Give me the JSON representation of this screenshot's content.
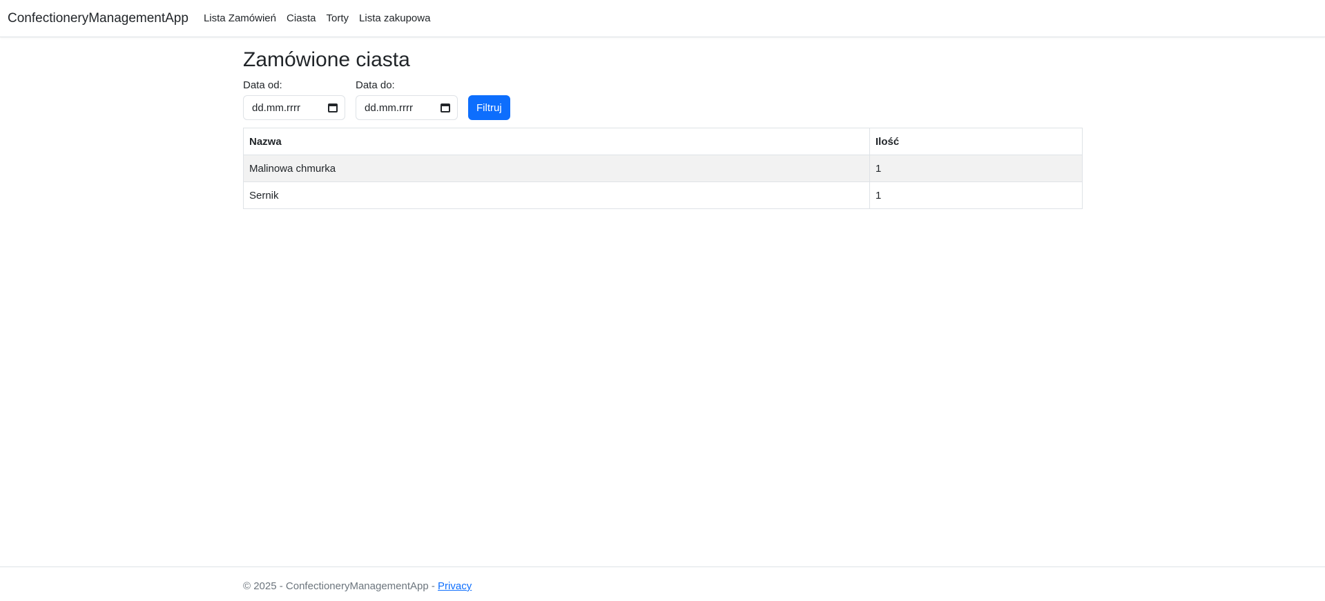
{
  "navbar": {
    "brand": "ConfectioneryManagementApp",
    "links": [
      {
        "label": "Lista Zamówień"
      },
      {
        "label": "Ciasta"
      },
      {
        "label": "Torty"
      },
      {
        "label": "Lista zakupowa"
      }
    ]
  },
  "main": {
    "title": "Zamówione ciasta",
    "filter": {
      "date_from_label": "Data od:",
      "date_from_placeholder": "dd.mm.rrrr",
      "date_to_label": "Data do:",
      "date_to_placeholder": "dd.mm.rrrr",
      "submit_label": "Filtruj"
    },
    "table": {
      "columns": [
        "Nazwa",
        "Ilość"
      ],
      "rows": [
        [
          "Malinowa chmurka",
          "1"
        ],
        [
          "Sernik",
          "1"
        ]
      ]
    }
  },
  "footer": {
    "copyright": "© 2025 - ConfectioneryManagementApp - ",
    "privacy_label": "Privacy"
  },
  "colors": {
    "accent": "#0d6efd",
    "striped_row": "#f2f2f2",
    "border": "#dee2e6",
    "footer_text": "#6c757d"
  },
  "icons": {
    "date_picker": "calendar-icon"
  }
}
